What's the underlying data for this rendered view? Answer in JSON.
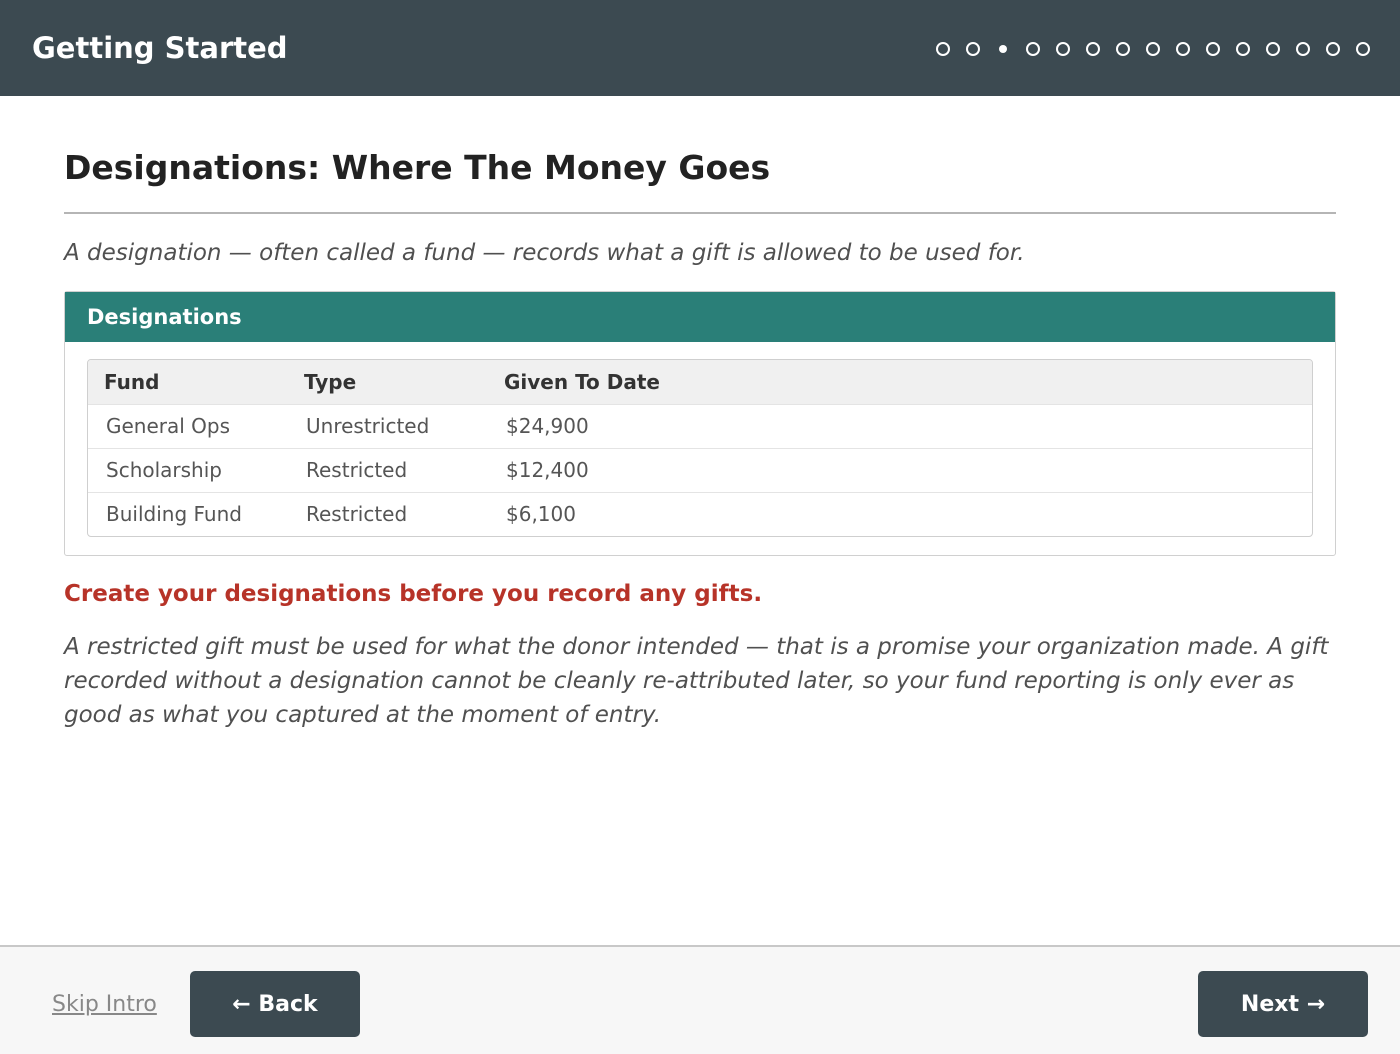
{
  "header": {
    "title": "Getting Started",
    "progress": {
      "total_steps": 15,
      "current_step": 3
    }
  },
  "main": {
    "heading": "Designations: Where The Money Goes",
    "intro": "A designation — often called a fund — records what a gift is allowed to be used for.",
    "panel": {
      "title": "Designations",
      "columns": [
        "Fund",
        "Type",
        "Given To Date"
      ],
      "rows": [
        [
          "General Ops",
          "Unrestricted",
          "$24,900"
        ],
        [
          "Scholarship",
          "Restricted",
          "$12,400"
        ],
        [
          "Building Fund",
          "Restricted",
          "$6,100"
        ]
      ]
    },
    "warning": "Create your designations before you record any gifts.",
    "body": "A restricted gift must be used for what the donor intended — that is a promise your organization made. A gift recorded without a designation cannot be cleanly re-attributed later, so your fund reporting is only ever as good as what you captured at the moment of entry."
  },
  "footer": {
    "skip_label": "Skip Intro",
    "back_label": "← Back",
    "next_label": "Next →"
  },
  "colors": {
    "header_bg": "#3c4a51",
    "panel_header_bg": "#2a7f78",
    "warning": "#b73328"
  }
}
